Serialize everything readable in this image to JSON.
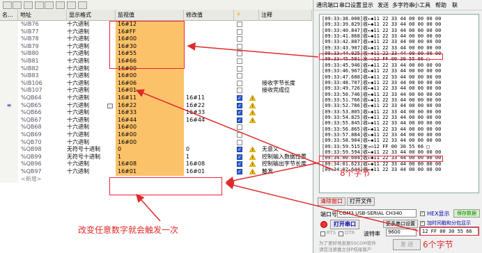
{
  "plc_table": {
    "headers": {
      "name": "名...",
      "address": "地址",
      "format": "显示格式",
      "monitor": "监视值",
      "modify": "修改值",
      "flag_icon": "lightning-icon",
      "note": "注释"
    },
    "rows": [
      {
        "marker": "",
        "addr": "%IB76",
        "fmt": "十六进制",
        "mon": "16#12",
        "mod": "",
        "chk": false,
        "warn": false,
        "note": ""
      },
      {
        "marker": "",
        "addr": "%IB77",
        "fmt": "十六进制",
        "mon": "16#FF",
        "mod": "",
        "chk": false,
        "warn": false,
        "note": ""
      },
      {
        "marker": "",
        "addr": "%IB78",
        "fmt": "十六进制",
        "mon": "16#00",
        "mod": "",
        "chk": false,
        "warn": false,
        "note": ""
      },
      {
        "marker": "",
        "addr": "%IB79",
        "fmt": "十六进制",
        "mon": "16#30",
        "mod": "",
        "chk": false,
        "warn": false,
        "note": ""
      },
      {
        "marker": "",
        "addr": "%IB80",
        "fmt": "十六进制",
        "mon": "16#55",
        "mod": "",
        "chk": false,
        "warn": false,
        "note": ""
      },
      {
        "marker": "",
        "addr": "%IB81",
        "fmt": "十六进制",
        "mon": "16#66",
        "mod": "",
        "chk": false,
        "warn": false,
        "note": ""
      },
      {
        "marker": "",
        "addr": "%IB82",
        "fmt": "十六进制",
        "mon": "16#00",
        "mod": "",
        "chk": false,
        "warn": false,
        "note": ""
      },
      {
        "marker": "",
        "addr": "%IB83",
        "fmt": "十六进制",
        "mon": "16#00",
        "mod": "",
        "chk": false,
        "warn": false,
        "note": ""
      },
      {
        "marker": "",
        "addr": "%IB106",
        "fmt": "十六进制",
        "mon": "16#06",
        "mod": "",
        "chk": false,
        "warn": false,
        "note": "接收字节长度"
      },
      {
        "marker": "",
        "addr": "%IB107",
        "fmt": "十六进制",
        "mon": "16#01",
        "mod": "",
        "chk": false,
        "warn": false,
        "note": "接收完成位"
      },
      {
        "marker": "",
        "addr": "%QB64",
        "fmt": "十六进制",
        "mon": "16#11",
        "mod": "16#11",
        "chk": true,
        "warn": true,
        "note": ""
      },
      {
        "marker": "≡",
        "addr": "%QB65",
        "fmt": "十六进制",
        "mon": "16#22",
        "mod": "16#22",
        "chk": true,
        "warn": true,
        "note": "",
        "dropdown": true
      },
      {
        "marker": "",
        "addr": "%QB66",
        "fmt": "十六进制",
        "mon": "16#33",
        "mod": "16#33",
        "chk": true,
        "warn": true,
        "note": ""
      },
      {
        "marker": "",
        "addr": "%QB67",
        "fmt": "十六进制",
        "mon": "16#44",
        "mod": "16#44",
        "chk": true,
        "warn": true,
        "note": ""
      },
      {
        "marker": "",
        "addr": "%QB68",
        "fmt": "十六进制",
        "mon": "16#00",
        "mod": "",
        "chk": false,
        "warn": false,
        "note": ""
      },
      {
        "marker": "",
        "addr": "%QB69",
        "fmt": "十六进制",
        "mon": "16#00",
        "mod": "",
        "chk": false,
        "warn": false,
        "note": ""
      },
      {
        "marker": "",
        "addr": "%QB70",
        "fmt": "十六进制",
        "mon": "16#00",
        "mod": "",
        "chk": false,
        "warn": false,
        "note": ""
      },
      {
        "marker": "",
        "addr": "%QB98",
        "fmt": "无符号十进制",
        "mon": "0",
        "mod": "0",
        "chk": true,
        "warn": true,
        "note": "无意义"
      },
      {
        "marker": "",
        "addr": "%QB99",
        "fmt": "无符号十进制",
        "mon": "1",
        "mod": "1",
        "chk": true,
        "warn": true,
        "note": "控制输入数据位置"
      },
      {
        "marker": "",
        "addr": "%QB96",
        "fmt": "十六进制",
        "mon": "16#08",
        "mod": "16#08",
        "chk": true,
        "warn": true,
        "note": "控制输出字节长度"
      },
      {
        "marker": "",
        "addr": "%QB97",
        "fmt": "十六进制",
        "mon": "16#01",
        "mod": "16#01",
        "chk": true,
        "warn": true,
        "note": "触发"
      },
      {
        "marker": "",
        "addr": "<新增>",
        "fmt": "",
        "mon": "",
        "mod": "",
        "chk": false,
        "warn": false,
        "note": "",
        "newrow": true
      }
    ]
  },
  "serial": {
    "menu": [
      "通讯端口",
      "串口设置",
      "显示",
      "发送",
      "多字符串",
      "小工具",
      "帮助",
      "联"
    ],
    "log": [
      "[09:33:38.008]收←◆11 22 33 44 00 00 00 00",
      "[09:33:39.829]收←◆11 22 33 44 00 00 00 00",
      "[09:33:40.847]收←◆11 22 33 44 00 00 00 00",
      "[09:33:41.868]收←◆11 22 33 44 00 00 00 00",
      "[09:33:42.887]收←◆11 22 33 44 00 00 00 00",
      "[09:33:43.907]收←◆11 22 33 44 00 00 00 00",
      "[09:33:44.925]收←◆11 22 33 44 00 00 00 00",
      "[09:33:45.581]发→◇12 FF 00 30 55 66 □",
      "[09:33:45.946]收←◆11 22 33 44 00 00 00 00",
      "[09:33:46.967]收←◆11 22 33 44 00 00 00 00",
      "[09:33:47.688]收←◆11 22 33 44 00 00 00 00",
      "[09:33:48.707]收←◆11 22 33 44 00 00 00 00",
      "[09:33:49.726]收←◆11 22 33 44 00 00 00 00",
      "[09:33:50.746]收←◆11 22 33 44 00 00 00 00",
      "[09:33:51.766]收←◆11 22 33 44 00 00 00 00",
      "[09:33:52.786]收←◆11 22 33 44 00 00 00 00",
      "[09:33:53.805]收←◆11 22 33 44 00 00 00 00",
      "[09:33:54.825]收←◆11 22 33 44 00 00 00 00",
      "[09:33:55.845]收←◆11 22 33 44 00 00 00 00",
      "[09:33:56.865]收←◆11 22 33 44 00 00 00 00",
      "[09:33:57.884]收←◆11 22 33 44 00 00 00 00",
      "[09:33:58.904]收←◆11 22 33 44 00 00 00 00",
      "[09:33:59.515]发→◇12 FF 00 30 55 66 □",
      "[09:33:59.594]收←◆11 22 33 44 00 00 00 00",
      "[09:34:00.604]收←◆11 22 33 44 00 00 00 00",
      "[09:34:01.623]收←◆11 22 33 44 00 00 00 00",
      "[09:34:02.644]收←◆11 22 33 44 00 00 00 00"
    ],
    "clear_btn": "清除窗口",
    "open_file_btn": "打开文件",
    "port_label": "端口号",
    "port_value": "COM3 USB-SERIAL CH340",
    "hex_display": "HEX显示",
    "save_data": "保存数据",
    "add_timestamp": "加时间戳和分包显示",
    "open_port_btn": "打开串口",
    "more_settings": "更多串口设置",
    "rts": "RTS",
    "dtr": "DTR",
    "baud_label": "波特率",
    "baud_value": "9600",
    "send_input": "12 FF 00 30 55 66",
    "promo": "为了更好地发展SSCOM软件",
    "promo2": "请您注册嘉立创P结尾客户",
    "send_btn": "发 送"
  },
  "annotations": {
    "bytes8": "8个字节",
    "bytes6": "6个字节",
    "trigger": "改变任意数字就会触发一次"
  },
  "colors": {
    "monitor_fill": "#fbc26a",
    "annotation_red": "#e02a2a"
  }
}
